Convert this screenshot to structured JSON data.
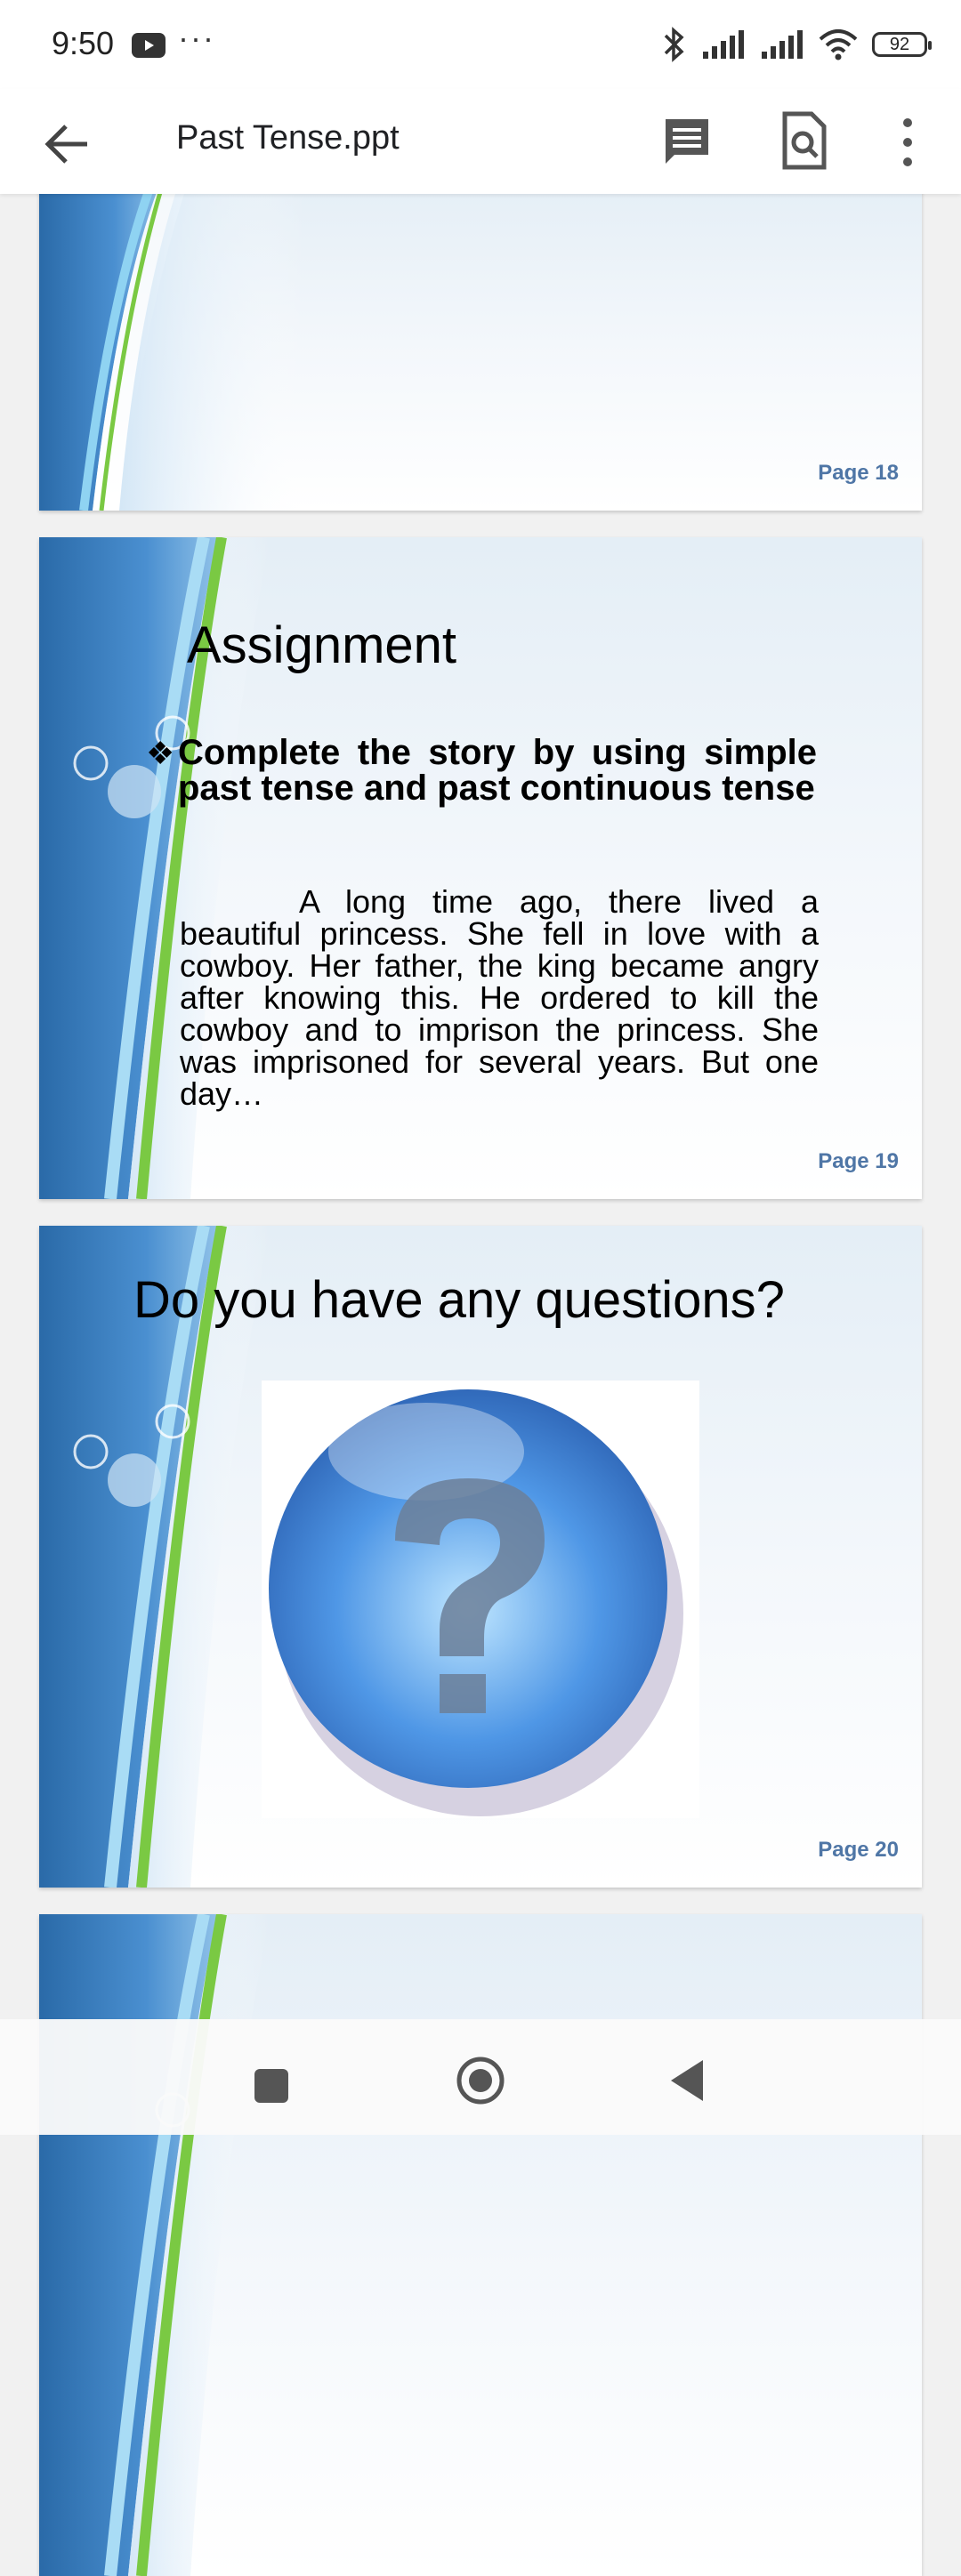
{
  "status_bar": {
    "time": "9:50",
    "dots": "···",
    "battery": "92",
    "icons": [
      "youtube-icon",
      "bluetooth-icon",
      "signal-icon",
      "signal-icon",
      "wifi-icon",
      "battery-icon"
    ]
  },
  "app_bar": {
    "title": "Past Tense.ppt",
    "icons": [
      "back-arrow-icon",
      "comment-icon",
      "find-in-page-icon",
      "more-vert-icon"
    ]
  },
  "slides": [
    {
      "page": "Page 18"
    },
    {
      "page": "Page 19",
      "title": "Assignment",
      "bullet_mark": "❖",
      "bullet": "Complete the story by using simple past tense and past continuous tense",
      "story": "A long time ago, there lived a beautiful princess. She fell in love with a cowboy. Her father, the king became angry after knowing this. He ordered to kill the cowboy and to imprison the princess. She was imprisoned for several years. But one day…"
    },
    {
      "page": "Page 20",
      "title": "Do you have any questions?",
      "image": "question-mark-icon"
    },
    {
      "page": ""
    }
  ],
  "nav_bar": {
    "icons": [
      "recents-square-icon",
      "home-circle-icon",
      "back-triangle-icon"
    ]
  },
  "colors": {
    "page_number": "#4f76a6",
    "slide_blue": "#2f73b8",
    "slide_green": "#7ac943"
  }
}
